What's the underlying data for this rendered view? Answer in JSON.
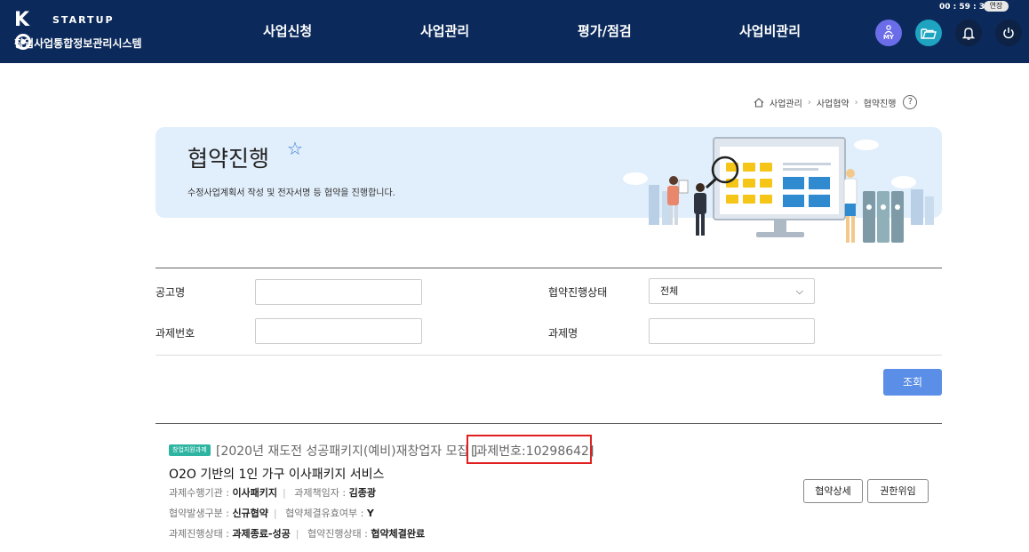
{
  "header": {
    "logo_text": "STARTUP",
    "logo_sub": "창업사업통합정보관리시스템",
    "nav": [
      "사업신청",
      "사업관리",
      "평가/점검",
      "사업비관리"
    ],
    "timer": "00 : 59 : 32",
    "extend_label": "연장",
    "my_label": "MY"
  },
  "breadcrumb": [
    "사업관리",
    "사업협약",
    "협약진행"
  ],
  "banner": {
    "title": "협약진행",
    "description": "수정사업계획서 작성 및 전자서명 등 협약을 진행합니다."
  },
  "form": {
    "notice_label": "공고명",
    "notice_value": "",
    "status_label": "협약진행상태",
    "status_value": "전체",
    "task_no_label": "과제번호",
    "task_no_value": "",
    "task_name_label": "과제명",
    "task_name_value": "",
    "search_button": "조회"
  },
  "result": {
    "tag": "창업지원과제",
    "notice": "[2020년 재도전 성공패키지(예비)재창업자 모집 ]",
    "task_no": "[과제번호:10298642]",
    "task_name": "O2O 기반의 1인 가구 이사패키지 서비스",
    "rows": [
      {
        "label1": "과제수행기관 :",
        "value1": "이사패키지",
        "label2": "과제책임자 :",
        "value2": "김종광"
      },
      {
        "label1": "협약발생구분 :",
        "value1": "신규협약",
        "label2": "협약체결유효여부 :",
        "value2": "Y"
      },
      {
        "label1": "과제진행상태 :",
        "value1": "과제종료-성공",
        "label2": "협약진행상태 :",
        "value2": "협약체결완료"
      }
    ],
    "detail_button": "협약상세",
    "delegate_button": "권한위임"
  }
}
